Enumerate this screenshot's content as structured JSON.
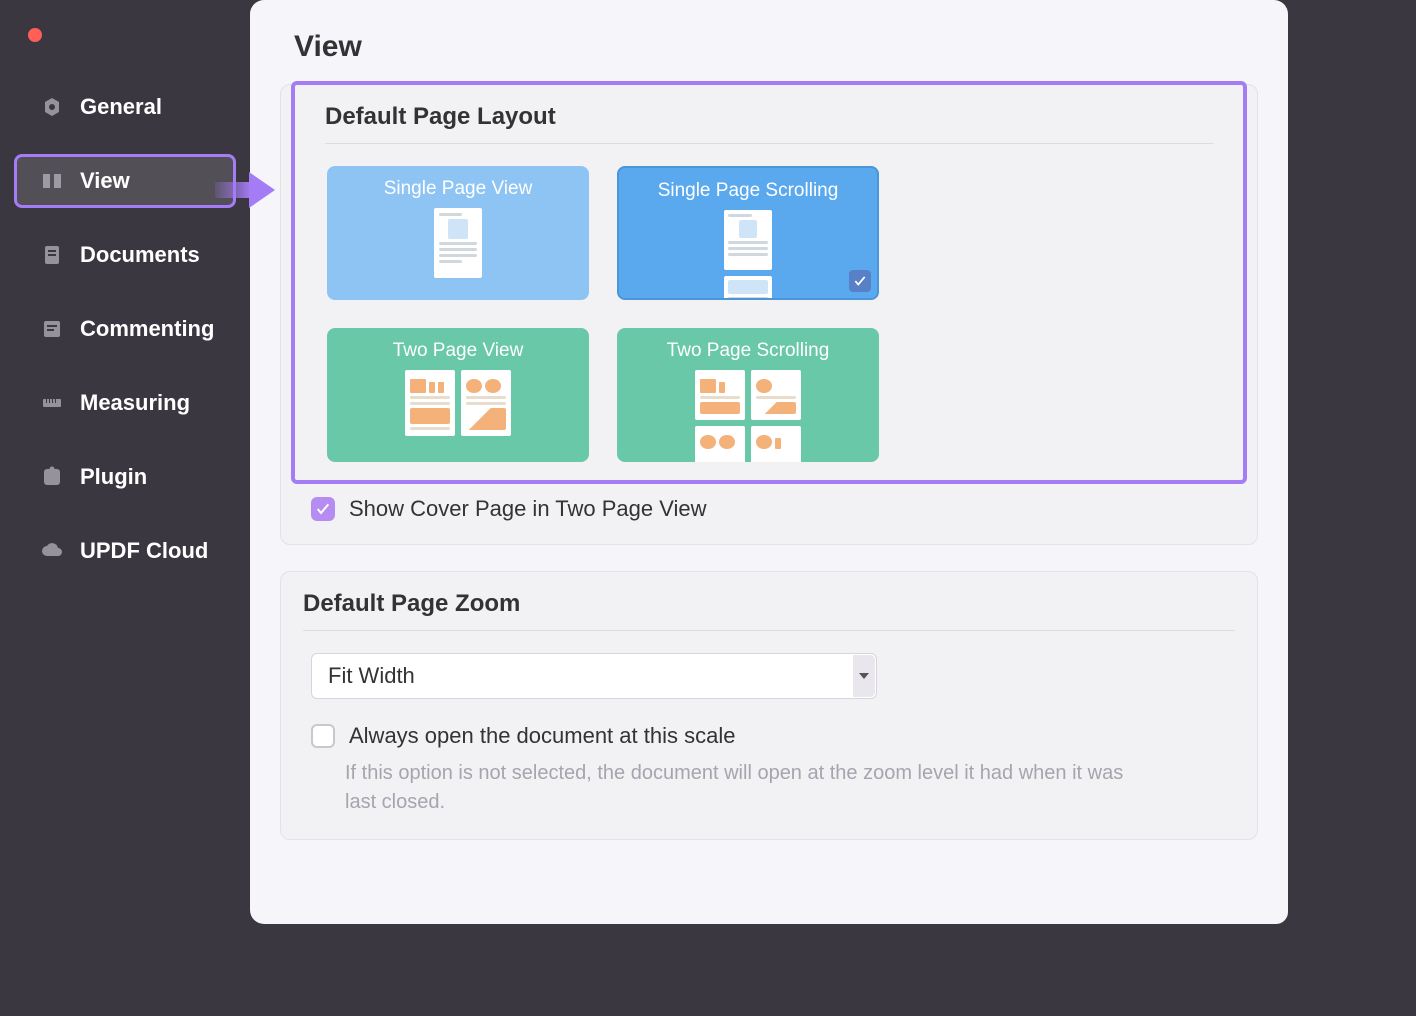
{
  "header": {
    "title": "View"
  },
  "sidebar": {
    "items": [
      {
        "label": "General"
      },
      {
        "label": "View"
      },
      {
        "label": "Documents"
      },
      {
        "label": "Commenting"
      },
      {
        "label": "Measuring"
      },
      {
        "label": "Plugin"
      },
      {
        "label": "UPDF Cloud"
      }
    ],
    "selected_index": 1
  },
  "sections": {
    "layout": {
      "title": "Default Page Layout",
      "options": [
        {
          "label": "Single Page View",
          "selected": false
        },
        {
          "label": "Single Page Scrolling",
          "selected": true
        },
        {
          "label": "Two Page View",
          "selected": false
        },
        {
          "label": "Two Page Scrolling",
          "selected": false
        }
      ],
      "cover_checkbox": {
        "checked": true,
        "label": "Show Cover Page in Two Page View"
      }
    },
    "zoom": {
      "title": "Default Page Zoom",
      "selected": "Fit Width",
      "always_open_checkbox": {
        "checked": false,
        "label": "Always open the document at this scale"
      },
      "hint": "If this option is not selected, the document will open at the zoom level it had when it was last closed."
    }
  },
  "colors": {
    "accent": "#a47cf5",
    "checkbox_fill": "#b48cf2",
    "tile_blue": "#5aa9ee",
    "tile_blue_light": "#8ec4f3",
    "tile_green": "#69c8a7"
  }
}
